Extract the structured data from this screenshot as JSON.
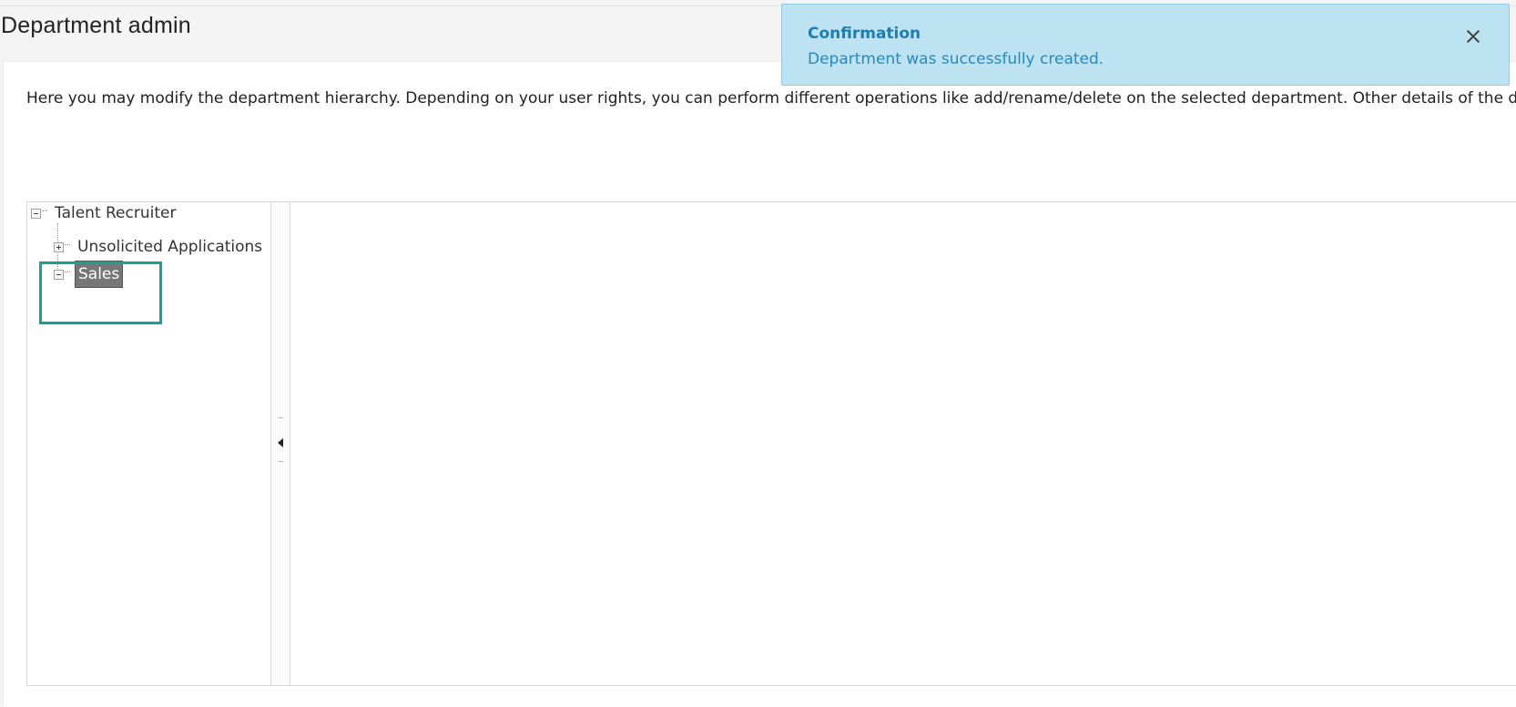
{
  "page": {
    "title": "Department admin",
    "description": "Here you may modify the department hierarchy. Depending on your user rights, you can perform different operations like add/rename/delete on the selected department. Other details of the de"
  },
  "tree": {
    "root": {
      "label": "Talent Recruiter",
      "expanded": true
    },
    "children": [
      {
        "label": "Unsolicited Applications",
        "expanded": false
      },
      {
        "label": "Sales",
        "expanded": true,
        "selected": true
      }
    ]
  },
  "notification": {
    "title": "Confirmation",
    "message": "Department was successfully created."
  },
  "colors": {
    "highlight": "#16a393",
    "toast_bg": "#bde3f3",
    "toast_text": "#1a7db4",
    "selected_node_bg": "#777777"
  },
  "icons": {
    "collapse": "minus-square-icon",
    "expand": "plus-square-icon",
    "close": "close-icon",
    "splitter": "triangle-left-icon"
  }
}
